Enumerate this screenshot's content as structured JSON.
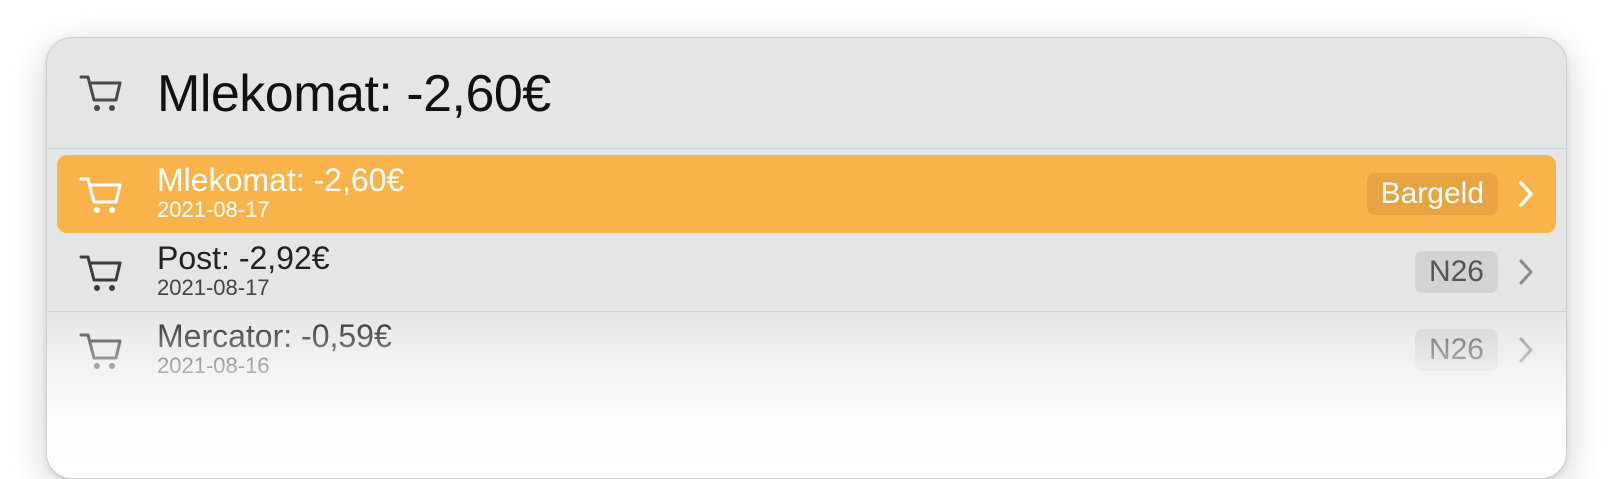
{
  "header": {
    "icon": "cart-icon",
    "title": "Mlekomat: -2,60€"
  },
  "colors": {
    "selected_background": "#f8b44b",
    "panel_background": "#e4e5e7"
  },
  "transactions": [
    {
      "icon": "cart-icon",
      "title": "Mlekomat: -2,60€",
      "date": "2021-08-17",
      "account": "Bargeld",
      "selected": true
    },
    {
      "icon": "cart-icon",
      "title": "Post: -2,92€",
      "date": "2021-08-17",
      "account": "N26",
      "selected": false
    },
    {
      "icon": "cart-icon",
      "title": "Mercator: -0,59€",
      "date": "2021-08-16",
      "account": "N26",
      "selected": false
    }
  ]
}
